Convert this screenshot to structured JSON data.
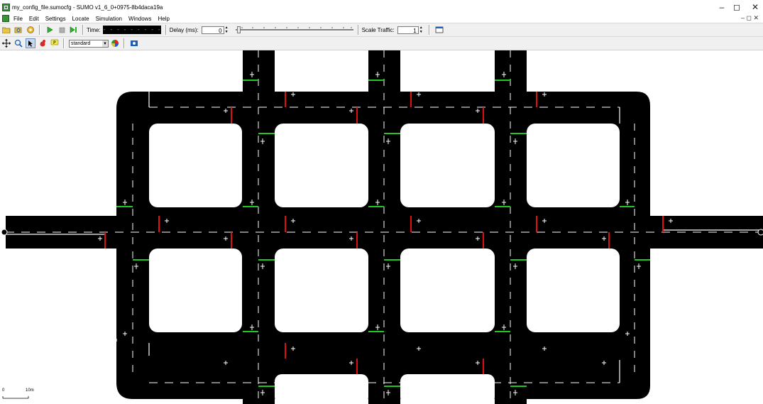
{
  "window": {
    "title": "my_config_file.sumocfg - SUMO v1_6_0+0975-8b4daca19a",
    "minimize_glyph": "–",
    "maximize_glyph": "◻",
    "close_glyph": "✕"
  },
  "menu": {
    "items": [
      "File",
      "Edit",
      "Settings",
      "Locate",
      "Simulation",
      "Windows",
      "Help"
    ],
    "mdi_controls": "– ◻ ✕"
  },
  "toolbar": {
    "time_label": "Time:",
    "time_value": "- - - - - - - - - - - - - -",
    "delay_label": "Delay (ms):",
    "delay_value": "0",
    "delay_slider_level": 0,
    "scale_label": "Scale Traffic:",
    "scale_value": "1"
  },
  "view_toolbar": {
    "scheme_selected": "standard"
  },
  "scale": {
    "zero": "0",
    "ten": "10m"
  },
  "colors": {
    "road": "#000000",
    "green_signal": "#22c822",
    "red_signal": "#e01010",
    "lane_marking": "#ffffff"
  }
}
